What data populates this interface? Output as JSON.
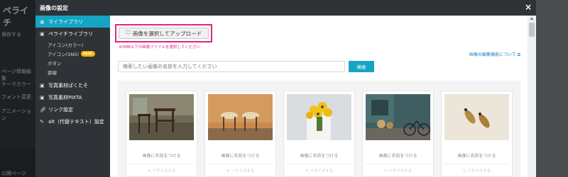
{
  "background": {
    "logo": "ペライチ",
    "items": [
      "保存する",
      "ページ情報編集",
      "テーマカラー",
      "フォント変更",
      "アニメーション"
    ],
    "bottom_label": "公開ページ"
  },
  "modal": {
    "title": "画像の設定",
    "close_label": "×",
    "sidebar": {
      "items": [
        {
          "label": "マイライブラリ",
          "icon": "image-icon",
          "active": true
        },
        {
          "label": "ペライチライブラリ",
          "icon": "image-icon",
          "active": false
        }
      ],
      "subitems": [
        {
          "label": "アイコン(カラー)"
        },
        {
          "label": "アイコン(SNS)",
          "badge": "new!"
        },
        {
          "label": "ボタン"
        },
        {
          "label": "罫線"
        }
      ],
      "items2": [
        {
          "label": "写真素材ぱくたそ",
          "icon": "image-icon"
        },
        {
          "label": "写真素材PIXTA",
          "icon": "image-icon"
        },
        {
          "label": "リンク設定",
          "icon": "link-icon"
        },
        {
          "label": "alt（代替テキスト）設定",
          "icon": "pencil-icon"
        }
      ]
    },
    "upload_button": "画像を選択してアップロード",
    "upload_note": "※5MB以下の画像ファイルを選択してください",
    "help_link": "画像の編集機能について",
    "search_placeholder": "検索したい画像の名前を入力してください",
    "search_button": "検索",
    "cards": [
      {
        "name": "画像に名前をつける",
        "resize": "リサイズする"
      },
      {
        "name": "画像に名前をつける",
        "resize": "リサイズする"
      },
      {
        "name": "画像に名前をつける",
        "resize": "リサイズする"
      },
      {
        "name": "画像に名前をつける",
        "resize": "リサイズする"
      },
      {
        "name": "画像に名前をつける",
        "resize": "リサイズする"
      }
    ]
  }
}
